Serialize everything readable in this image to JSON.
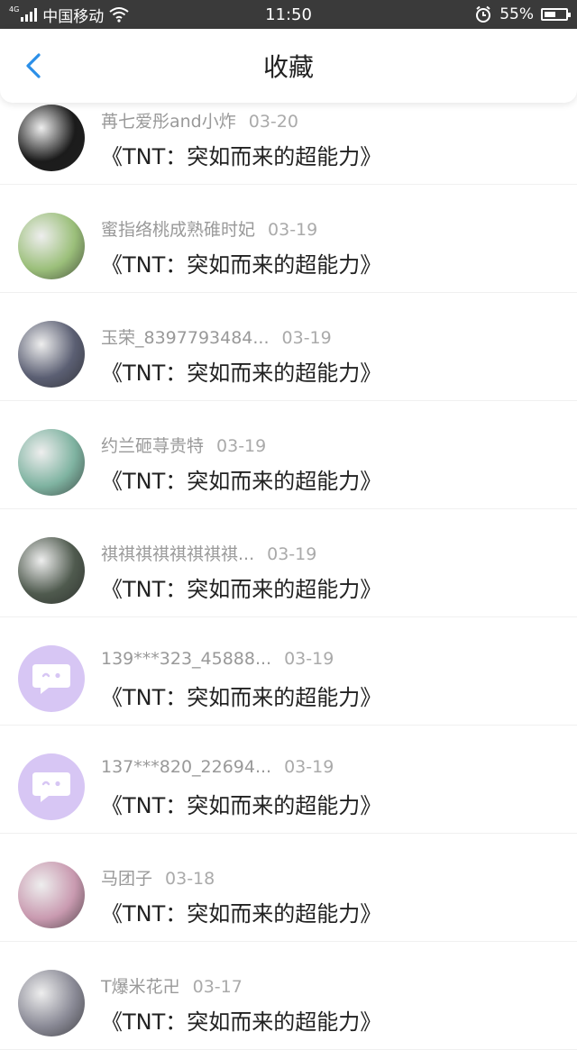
{
  "status_bar": {
    "network": "4G",
    "carrier": "中国移动",
    "time": "11:50",
    "battery_percent_text": "55%",
    "battery_level": 0.55
  },
  "nav": {
    "title": "收藏"
  },
  "items": [
    {
      "user": "苒七爱彤and小炸",
      "date": "03-20",
      "title": "《TNT：突如而来的超能力》",
      "avatar": "photo",
      "avatar_color": "#1b1b1b"
    },
    {
      "user": "蜜指络桃成熟碓时妃",
      "date": "03-19",
      "title": "《TNT：突如而来的超能力》",
      "avatar": "photo",
      "avatar_color": "#9bbf7a"
    },
    {
      "user": "玉荣_8397793484...",
      "date": "03-19",
      "title": "《TNT：突如而来的超能力》",
      "avatar": "photo",
      "avatar_color": "#5b5f73"
    },
    {
      "user": "约兰砸荨贵特",
      "date": "03-19",
      "title": "《TNT：突如而来的超能力》",
      "avatar": "photo",
      "avatar_color": "#7fb3a1"
    },
    {
      "user": "祺祺祺祺祺祺祺祺...",
      "date": "03-19",
      "title": "《TNT：突如而来的超能力》",
      "avatar": "photo",
      "avatar_color": "#4f5a4e"
    },
    {
      "user": "139***323_45888...",
      "date": "03-19",
      "title": "《TNT：突如而来的超能力》",
      "avatar": "default",
      "avatar_color": "#d7c6f4"
    },
    {
      "user": "137***820_22694...",
      "date": "03-19",
      "title": "《TNT：突如而来的超能力》",
      "avatar": "default",
      "avatar_color": "#d7c6f4"
    },
    {
      "user": "马团子",
      "date": "03-18",
      "title": "《TNT：突如而来的超能力》",
      "avatar": "photo",
      "avatar_color": "#c99ab0"
    },
    {
      "user": "T爆米花卍",
      "date": "03-17",
      "title": "《TNT：突如而来的超能力》",
      "avatar": "photo",
      "avatar_color": "#8a8a96"
    }
  ],
  "colors": {
    "accent": "#2b8fe8",
    "status_bar_bg": "#3a3a3a",
    "default_avatar": "#d7c6f4"
  },
  "icons": {
    "back": "chevron-left-icon",
    "default_avatar": "chat-bubble-icon",
    "alarm": "alarm-icon",
    "wifi": "wifi-icon",
    "signal": "signal-icon",
    "battery": "battery-icon"
  }
}
